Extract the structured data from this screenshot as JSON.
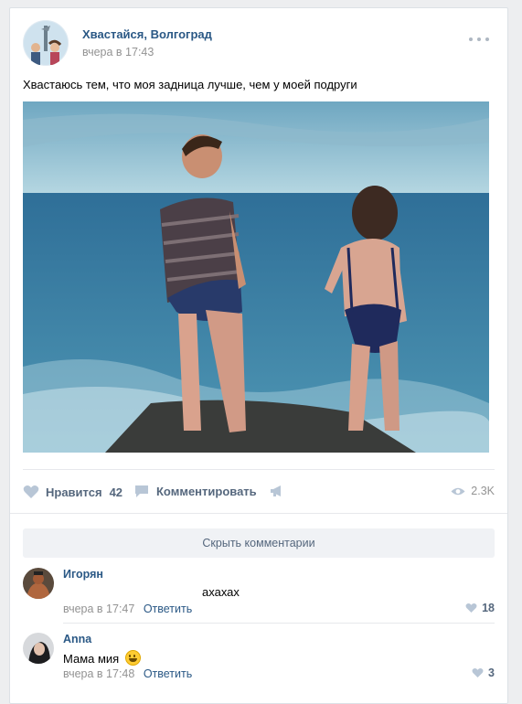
{
  "post": {
    "author": "Хвастайся, Волгоград",
    "time": "вчера в 17:43",
    "text": "Хвастаюсь тем, что моя задница лучше, чем у моей подруги",
    "icons": [
      "more-dots-icon",
      "heart-icon",
      "comment-icon",
      "share-megaphone-icon",
      "eye-icon"
    ]
  },
  "actions": {
    "like_label": "Нравится",
    "like_count": "42",
    "comment_label": "Комментировать",
    "views": "2.3K"
  },
  "comments_toggle": "Скрыть комментарии",
  "comments": [
    {
      "author": "Игорян",
      "text": "ахахах",
      "time": "вчера в 17:47",
      "reply": "Ответить",
      "likes": "18"
    },
    {
      "author": "Anna",
      "text": "Мама мия",
      "time": "вчера в 17:48",
      "reply": "Ответить",
      "likes": "3"
    }
  ],
  "colors": {
    "link": "#2a5885",
    "muted": "#939393",
    "page_bg": "#edeef0",
    "sea": "#3a7fa8",
    "sky": "#8fc0d6"
  }
}
